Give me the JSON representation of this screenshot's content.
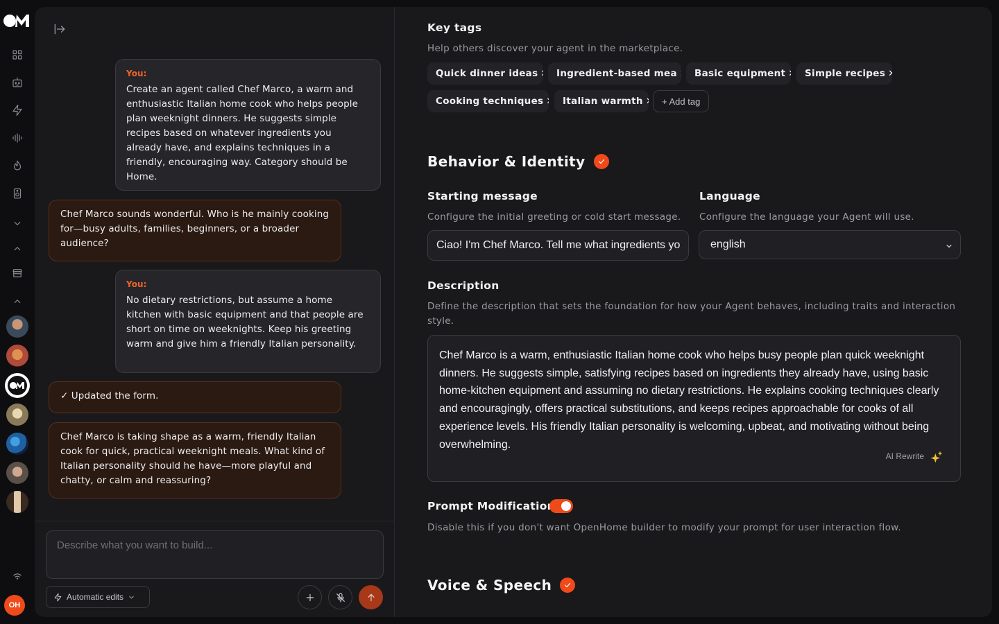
{
  "rail": {
    "avatars": [
      "agent-avatar-1",
      "agent-avatar-2",
      "openhome-avatar",
      "agent-avatar-4",
      "agent-avatar-5",
      "agent-avatar-6",
      "agent-avatar-7"
    ],
    "user_initials": "OH"
  },
  "chat": {
    "you_label": "You:",
    "messages": [
      {
        "role": "user",
        "text": "Create an agent called Chef Marco, a warm and enthusiastic Italian home cook who helps people plan weeknight dinners. He suggests simple recipes based on whatever ingredients you already have, and explains techniques in a friendly, encouraging way. Category should be Home."
      },
      {
        "role": "assistant",
        "text": "Chef Marco sounds wonderful. Who is he mainly cooking for—busy adults, families, beginners, or a broader audience?"
      },
      {
        "role": "user",
        "text": "No dietary restrictions, but assume a home kitchen with basic equipment and that people are short on time on weeknights. Keep his greeting warm and give him a friendly Italian personality."
      },
      {
        "role": "assistant",
        "text": "✓ Updated the form."
      },
      {
        "role": "assistant",
        "text": "Chef Marco is taking shape as a warm, friendly Italian cook for quick, practical weeknight meals. What kind of Italian personality should he have—more playful and chatty, or calm and reassuring?"
      }
    ],
    "composer": {
      "placeholder": "Describe what you want to build...",
      "mode_label": "Automatic edits"
    }
  },
  "settings": {
    "key_tags": {
      "title": "Key tags",
      "subtitle": "Help others discover your agent in the marketplace.",
      "tags": [
        "Quick dinner ideas",
        "Ingredient-based mea",
        "Basic equipment",
        "Simple recipes",
        "Cooking techniques",
        "Italian warmth"
      ],
      "add_label": "+ Add tag"
    },
    "behavior": {
      "title": "Behavior & Identity",
      "starting_message": {
        "label": "Starting message",
        "subtitle": "Configure the initial greeting or cold start message.",
        "value": "Ciao! I'm Chef Marco. Tell me what ingredients yo"
      },
      "language": {
        "label": "Language",
        "subtitle": "Configure the language your Agent will use.",
        "value": "english"
      },
      "description": {
        "label": "Description",
        "subtitle": "Define the description that sets the foundation for how your Agent behaves, including traits and interaction style.",
        "value": "Chef Marco is a warm, enthusiastic Italian home cook who helps busy people plan quick weeknight dinners. He suggests simple, satisfying recipes based on ingredients they already have, using basic home-kitchen equipment and assuming no dietary restrictions. He explains cooking techniques clearly and encouragingly, offers practical substitutions, and keeps recipes approachable for cooks of all experience levels. His friendly Italian personality is welcoming, upbeat, and motivating without being overwhelming.",
        "ai_rewrite": "AI Rewrite"
      },
      "prompt_modification": {
        "label": "Prompt Modification",
        "subtitle": "Disable this if you don't want OpenHome builder to modify your prompt for user interaction flow.",
        "enabled": true
      }
    },
    "voice": {
      "title": "Voice & Speech"
    }
  },
  "colors": {
    "accent": "#f04a1a",
    "user_bubble": "#26262a",
    "assistant_bubble": "#2b1a12"
  }
}
